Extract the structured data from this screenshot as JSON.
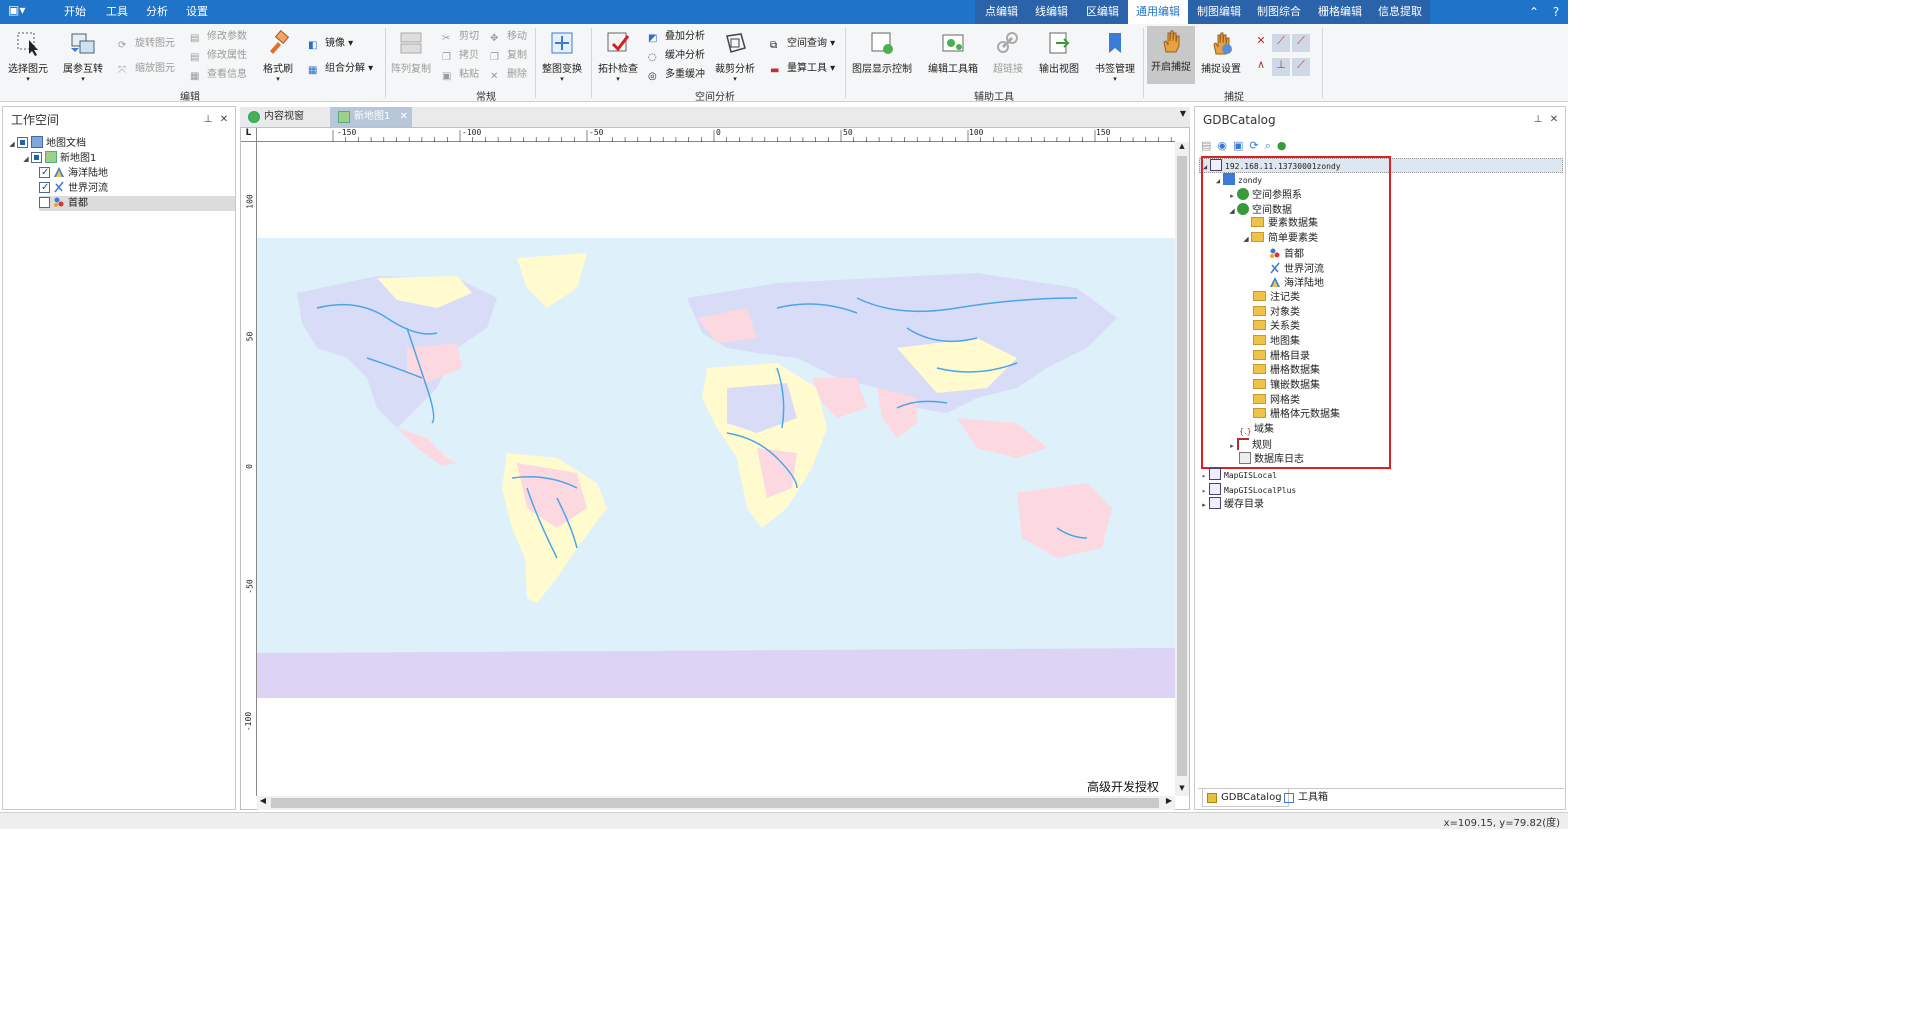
{
  "menu": {
    "tabs": [
      "开始",
      "工具",
      "分析",
      "设置"
    ],
    "right_tabs": [
      "点编辑",
      "线编辑",
      "区编辑",
      "通用编辑",
      "制图编辑",
      "制图综合",
      "栅格编辑",
      "信息提取"
    ],
    "active_tab": "通用编辑"
  },
  "ribbon": {
    "edit": {
      "select_element": "选择图元",
      "attr_swap": "属参互转",
      "rotate_element": "旋转图元",
      "scale_element": "缩放图元",
      "modify_params": "修改参数",
      "modify_attrs": "修改属性",
      "view_info": "查看信息",
      "format_brush": "格式刷",
      "mirror": "镜像",
      "group_split": "组合分解",
      "group_label": "编辑"
    },
    "normal": {
      "array_copy": "阵列复制",
      "cut": "剪切",
      "copy_clip": "拷贝",
      "paste": "粘贴",
      "move": "移动",
      "duplicate": "复制",
      "delete": "删除",
      "group_label": "常规"
    },
    "whole_transform": "整图变换",
    "spatial": {
      "topo_check": "拓扑检查",
      "overlay": "叠加分析",
      "buffer": "缓冲分析",
      "multi_buffer": "多重缓冲",
      "clip": "裁剪分析",
      "spatial_query": "空间查询",
      "measure": "量算工具",
      "group_label": "空间分析"
    },
    "aux": {
      "layer_display": "图层显示控制",
      "edit_toolbox": "编辑工具箱",
      "hyperlink": "超链接",
      "export_view": "输出视图",
      "bookmarks": "书签管理",
      "group_label": "辅助工具"
    },
    "snap": {
      "open_snap": "开启捕捉",
      "snap_settings": "捕捉设置",
      "group_label": "捕捉"
    }
  },
  "workspace": {
    "title": "工作空间",
    "items": [
      {
        "label": "地图文档"
      },
      {
        "label": "新地图1"
      },
      {
        "label": "海洋陆地"
      },
      {
        "label": "世界河流"
      },
      {
        "label": "首都"
      }
    ]
  },
  "doc_tabs": [
    {
      "label": "内容视窗"
    },
    {
      "label": "新地图1"
    }
  ],
  "map": {
    "h_ruler": [
      "-150",
      "-100",
      "-50",
      "0",
      "50",
      "100",
      "150"
    ],
    "v_ruler": [
      "100",
      "50",
      "0",
      "-50",
      "-100"
    ],
    "watermark": "高级开发授权",
    "colors": {
      "ocean": "#def1fb",
      "land_a": "#d8dcf7",
      "land_b": "#fcd8e0",
      "land_c": "#fffbcf",
      "river": "#4aa6e6",
      "antarctica": "#ddd4f5"
    }
  },
  "gdb": {
    "title": "GDBCatalog",
    "server": "192.168.11.13730001zondy",
    "db": "zondy",
    "items": [
      "空间参照系",
      "空间数据",
      "要素数据集",
      "简单要素类",
      "首都",
      "世界河流",
      "海洋陆地",
      "注记类",
      "对象类",
      "关系类",
      "地图集",
      "栅格目录",
      "栅格数据集",
      "镶嵌数据集",
      "网格类",
      "栅格体元数据集",
      "域集",
      "规则",
      "数据库日志"
    ],
    "others": [
      "MapGISLocal",
      "MapGISLocalPlus",
      "缓存目录"
    ],
    "highlight_color": "#e02020"
  },
  "bottom_tabs": [
    "GDBCatalog",
    "工具箱"
  ],
  "status": {
    "coords": "x=109.15, y=79.82(度)"
  }
}
